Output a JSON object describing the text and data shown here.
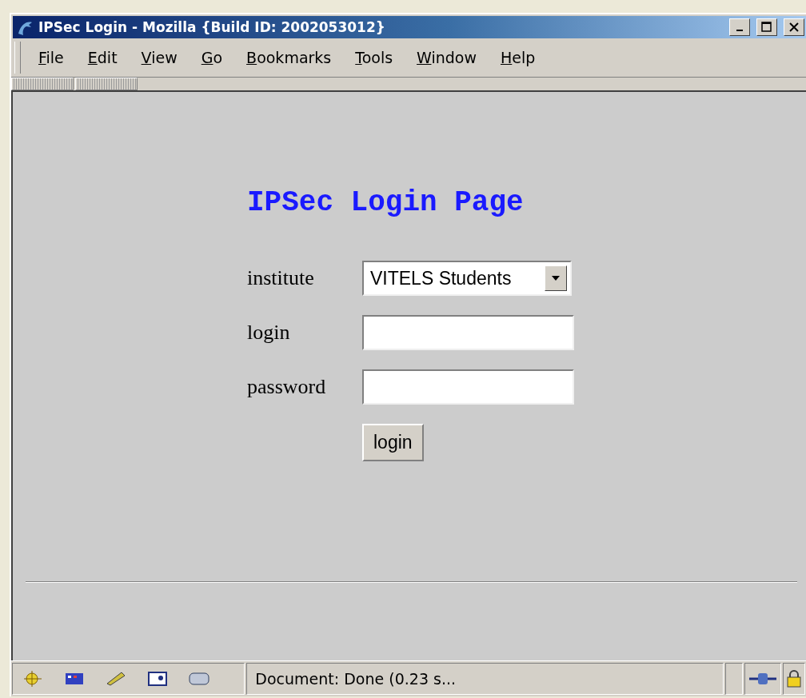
{
  "window": {
    "title": "IPSec Login - Mozilla {Build ID: 2002053012}"
  },
  "menu": [
    {
      "label": "File"
    },
    {
      "label": "Edit"
    },
    {
      "label": "View"
    },
    {
      "label": "Go"
    },
    {
      "label": "Bookmarks"
    },
    {
      "label": "Tools"
    },
    {
      "label": "Window"
    },
    {
      "label": "Help"
    }
  ],
  "page": {
    "heading": "IPSec Login Page",
    "fields": [
      {
        "kind": "select",
        "label": "institute",
        "value": "VITELS Students"
      },
      {
        "kind": "text",
        "label": "login"
      },
      {
        "kind": "password",
        "label": "password"
      }
    ],
    "button": "login"
  },
  "status_bar": {
    "text": "Document: Done (0.23 s..."
  }
}
